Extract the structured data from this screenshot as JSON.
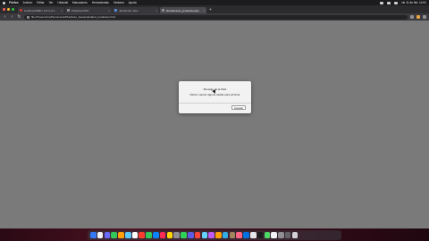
{
  "menubar": {
    "app_name": "Firefox",
    "menus": [
      "Archivo",
      "Editar",
      "Ver",
      "Historial",
      "Marcadores",
      "Herramientas",
      "Ventana",
      "Ayuda"
    ],
    "status_text": "vie 11 de feb. 14:51"
  },
  "tabs": [
    {
      "label": "localhost:8080 / 127.0.0.1",
      "favicon": "red",
      "active": false
    },
    {
      "label": "Prácticas PHP",
      "favicon": "grey",
      "active": false
    },
    {
      "label": "JavaScript: alert",
      "favicon": "blue",
      "active": false
    },
    {
      "label": "ifov/eliminar_productos.php",
      "favicon": "grey",
      "active": true
    }
  ],
  "toolbar": {
    "url": "file:///Users/nmp/Documents/Practicas_Javascript/alert_productos.html"
  },
  "dialog": {
    "title": "Mensaje de la Web",
    "message": "Debes marcar alguna casilla para eliminar",
    "ok_label": "Aceptar"
  },
  "dock": {
    "icon_colors": [
      "#3478f6",
      "#f2f2f7",
      "#6b6bff",
      "#34c759",
      "#ff9f0a",
      "#5ac8fa",
      "#ffffff",
      "#ff3b30",
      "#34c759",
      "#0a84ff",
      "#ff2d55",
      "#ffd60a",
      "#8e8e93",
      "#30d158",
      "#5e5ce6",
      "#ff453a",
      "#64d2ff",
      "#bf5af2",
      "#ff9f0a",
      "#32ade6",
      "#a2845e",
      "#ff6482",
      "#0071e3",
      "#e5e5ea",
      "#1c1c1e",
      "#4cd964",
      "#f2f2f7",
      "#8e8e93",
      "#636366",
      "#d1d1d6"
    ]
  }
}
